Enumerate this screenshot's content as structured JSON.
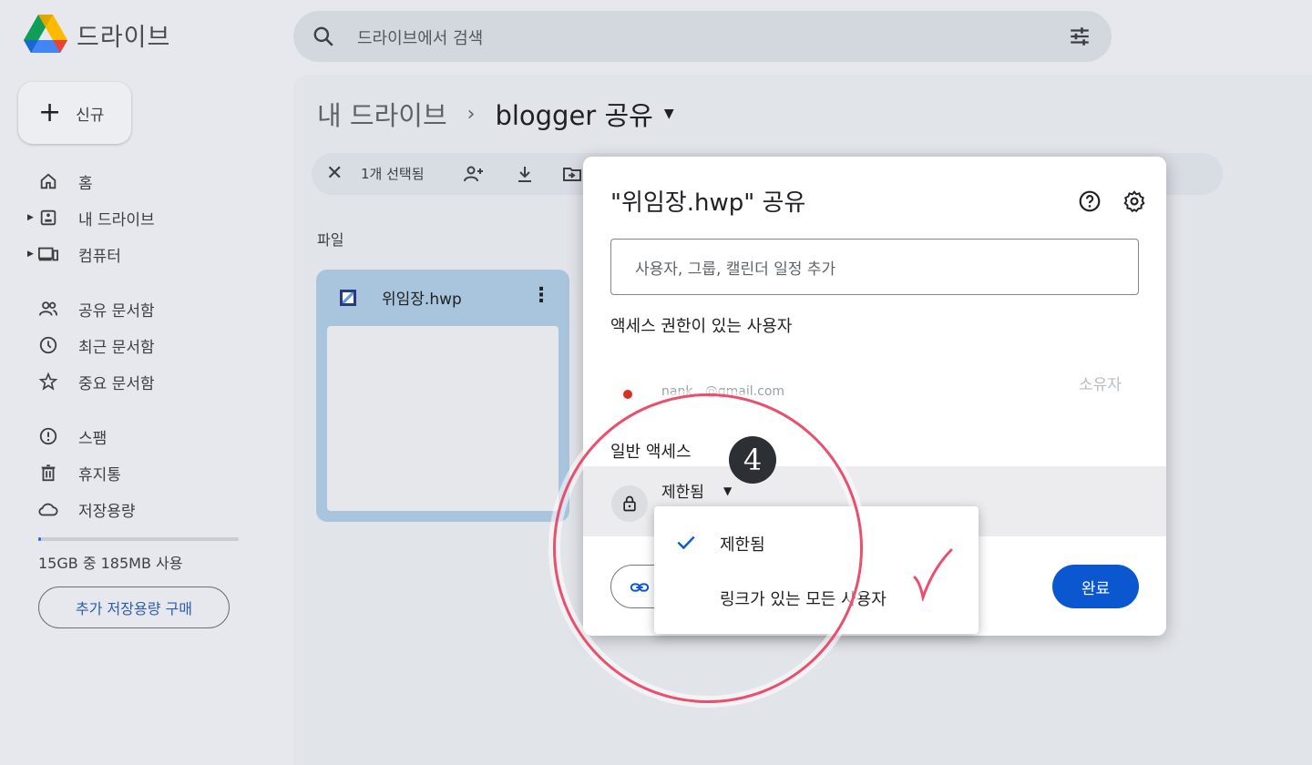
{
  "brand": "드라이브",
  "search": {
    "placeholder": "드라이브에서 검색"
  },
  "sidebar": {
    "new_label": "신규",
    "items": [
      {
        "label": "홈",
        "icon": "home-icon"
      },
      {
        "label": "내 드라이브",
        "icon": "my-drive-icon"
      },
      {
        "label": "컴퓨터",
        "icon": "computer-icon"
      },
      {
        "label": "공유 문서함",
        "icon": "shared-icon"
      },
      {
        "label": "최근 문서함",
        "icon": "clock-icon"
      },
      {
        "label": "중요 문서함",
        "icon": "star-icon"
      },
      {
        "label": "스팸",
        "icon": "spam-icon"
      },
      {
        "label": "휴지통",
        "icon": "trash-icon"
      },
      {
        "label": "저장용량",
        "icon": "cloud-icon"
      }
    ],
    "storage_text": "15GB 중 185MB 사용",
    "storage_used_fraction": 0.012,
    "buy_storage_label": "추가 저장용량 구매"
  },
  "breadcrumb": {
    "root": "내 드라이브",
    "current": "blogger 공유"
  },
  "actionbar": {
    "selected_count": "1개 선택됨"
  },
  "files": {
    "section_label": "파일",
    "items": [
      {
        "name": "위임장.hwp"
      }
    ]
  },
  "share_dialog": {
    "title": "\"위임장.hwp\" 공유",
    "add_people_placeholder": "사용자, 그룹, 캘린더 일정 추가",
    "access_heading": "액세스 권한이 있는 사용자",
    "owner_email_partial": "nank...@gmail.com",
    "owner_role": "소유자",
    "general_access_heading": "일반 액세스",
    "general_access_value": "제한됨",
    "done_label": "완료",
    "dropdown_options": [
      {
        "label": "제한됨",
        "selected": true
      },
      {
        "label": "링크가 있는 모든 사용자",
        "selected": false
      }
    ]
  },
  "annotation": {
    "step_number": "4"
  },
  "colors": {
    "accent": "#0b57d0",
    "annotation": "#e8506e"
  }
}
